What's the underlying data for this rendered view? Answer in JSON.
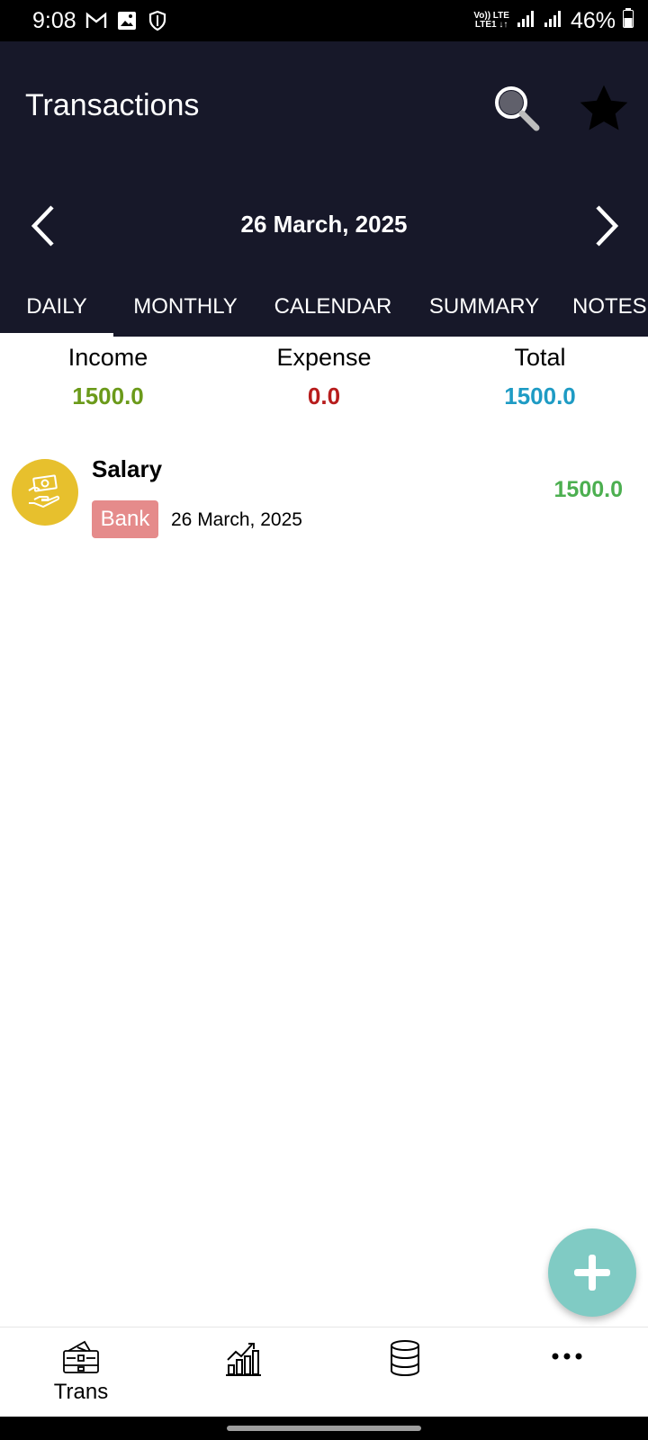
{
  "status_bar": {
    "time": "9:08",
    "network_top": "Vo)) LTE",
    "network_bottom": "LTE1 ↓↑",
    "battery": "46%"
  },
  "header": {
    "title": "Transactions",
    "current_date": "26 March, 2025"
  },
  "tabs": [
    {
      "label": "DAILY",
      "selected": true
    },
    {
      "label": "MONTHLY",
      "selected": false
    },
    {
      "label": "CALENDAR",
      "selected": false
    },
    {
      "label": "SUMMARY",
      "selected": false
    },
    {
      "label": "NOTES",
      "selected": false
    }
  ],
  "summary": {
    "income_label": "Income",
    "income_value": "1500.0",
    "expense_label": "Expense",
    "expense_value": "0.0",
    "total_label": "Total",
    "total_value": "1500.0",
    "colors": {
      "income": "#6B9A1A",
      "expense": "#B71C1C",
      "total": "#1E9BC4"
    }
  },
  "transactions": [
    {
      "title": "Salary",
      "account": "Bank",
      "date": "26 March, 2025",
      "amount": "1500.0",
      "icon": "cash-hand-icon",
      "icon_bg": "#E7C02D",
      "amount_color": "#4CAF50"
    }
  ],
  "bottom_nav": [
    {
      "label": "Trans",
      "icon": "wallet-icon"
    },
    {
      "label": "",
      "icon": "chart-growth-icon"
    },
    {
      "label": "",
      "icon": "database-icon"
    },
    {
      "label": "",
      "icon": "more-icon"
    }
  ],
  "fab": {
    "icon": "plus-icon",
    "color": "#80CBC4"
  },
  "theme": {
    "header_bg": "#171829"
  }
}
